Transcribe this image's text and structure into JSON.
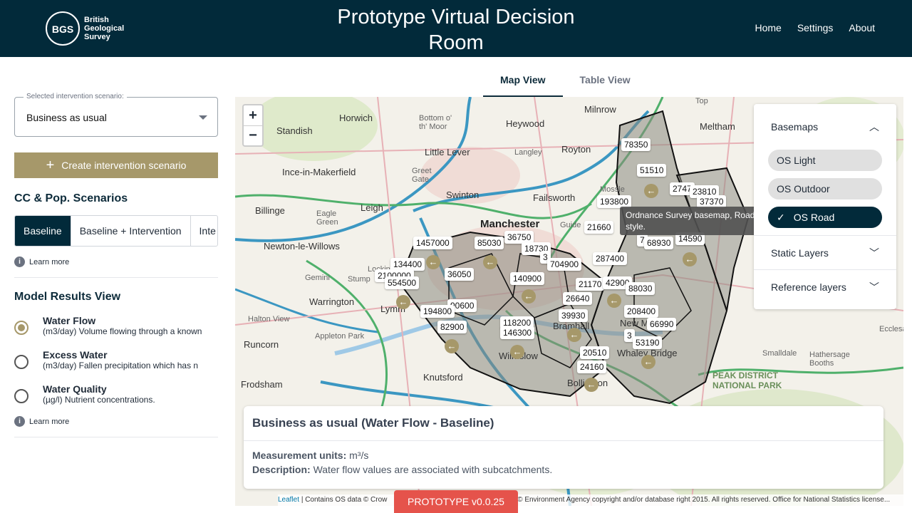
{
  "header": {
    "logo_mark": "BGS",
    "logo_line1": "British",
    "logo_line2": "Geological",
    "logo_line3": "Survey",
    "title": "Prototype Virtual Decision Room",
    "nav": [
      "Home",
      "Settings",
      "About"
    ]
  },
  "tabs": [
    {
      "label": "Map View",
      "active": true
    },
    {
      "label": "Table View",
      "active": false
    }
  ],
  "sidebar": {
    "scenario_legend": "Selected intervention scenario:",
    "scenario_value": "Business as usual",
    "create_button": "Create intervention scenario",
    "cc_title": "CC & Pop. Scenarios",
    "cc_options": [
      "Baseline",
      "Baseline + Intervention",
      "Inte"
    ],
    "learn_more": "Learn more",
    "model_title": "Model Results View",
    "model_options": [
      {
        "name": "Water Flow",
        "desc": "(m3/day) Volume flowing through a known",
        "selected": true
      },
      {
        "name": "Excess Water",
        "desc": "(m3/day) Fallen precipitation which has n",
        "selected": false
      },
      {
        "name": "Water Quality",
        "desc": "(µg/l) Nutrient concentrations.",
        "selected": false
      }
    ]
  },
  "map": {
    "zoom_in": "+",
    "zoom_out": "−",
    "places": [
      "Horwich",
      "Bottom o' th' Moor",
      "Heywood",
      "Milnrow",
      "Standish",
      "Little Lever",
      "Royton",
      "Meltham",
      "Ince-in-Makerfield",
      "Swinton",
      "Failsworth",
      "Billinge",
      "Leigh",
      "Manchester",
      "Newton-le-Willows",
      "Warrington",
      "Halton View",
      "Appleton Park",
      "Runcorn",
      "Frodsham",
      "Knutsford",
      "Smalldale",
      "Hathersage Booths",
      "Ecclesa",
      "Langley",
      "Greet Gate",
      "Eagle Green",
      "Guide",
      "Mossle",
      "Top",
      "Lymm",
      "Gemini",
      "Stump",
      "Locking",
      "Wilmslow",
      "Bollington",
      "Whaley Bridge",
      "New Mills",
      "Bramhall"
    ],
    "park_label": "PEAK DISTRICT NATIONAL PARK",
    "flow_labels": [
      "78350",
      "51510",
      "2747",
      "23810",
      "37370",
      "193800",
      "21660",
      "7",
      "68930",
      "14590",
      "1457000",
      "85030",
      "36750",
      "18730",
      "134400",
      "3",
      "704900",
      "287400",
      "36050",
      "2100000",
      "554500",
      "140900",
      "21170",
      "42900",
      "88030",
      "26640",
      "90600",
      "194800",
      "39930",
      "208400",
      "118200",
      "82900",
      "146300",
      "66990",
      "3",
      "53190",
      "20510",
      "24160"
    ]
  },
  "basemaps": {
    "title": "Basemaps",
    "options": [
      {
        "label": "OS Light",
        "selected": false
      },
      {
        "label": "OS Outdoor",
        "selected": false
      },
      {
        "label": "OS Road",
        "selected": true
      }
    ],
    "tooltip": "Ordnance Survey basemap, Road style.",
    "static_layers": "Static Layers",
    "reference_layers": "Reference layers"
  },
  "infobox": {
    "title": "Business as usual (Water Flow - Baseline)",
    "units_label": "Measurement units:",
    "units_value": "m³/s",
    "desc_label": "Description:",
    "desc_value": "Water flow values are associated with subcatchments."
  },
  "attribution": {
    "leaflet": "Leaflet",
    "text_left": "| Contains OS data © Crow",
    "text_right": "© Environment Agency copyright and/or database right 2015. All rights reserved. Office for National Statistics license..."
  },
  "prototype_badge": "PROTOTYPE v0.0.25"
}
